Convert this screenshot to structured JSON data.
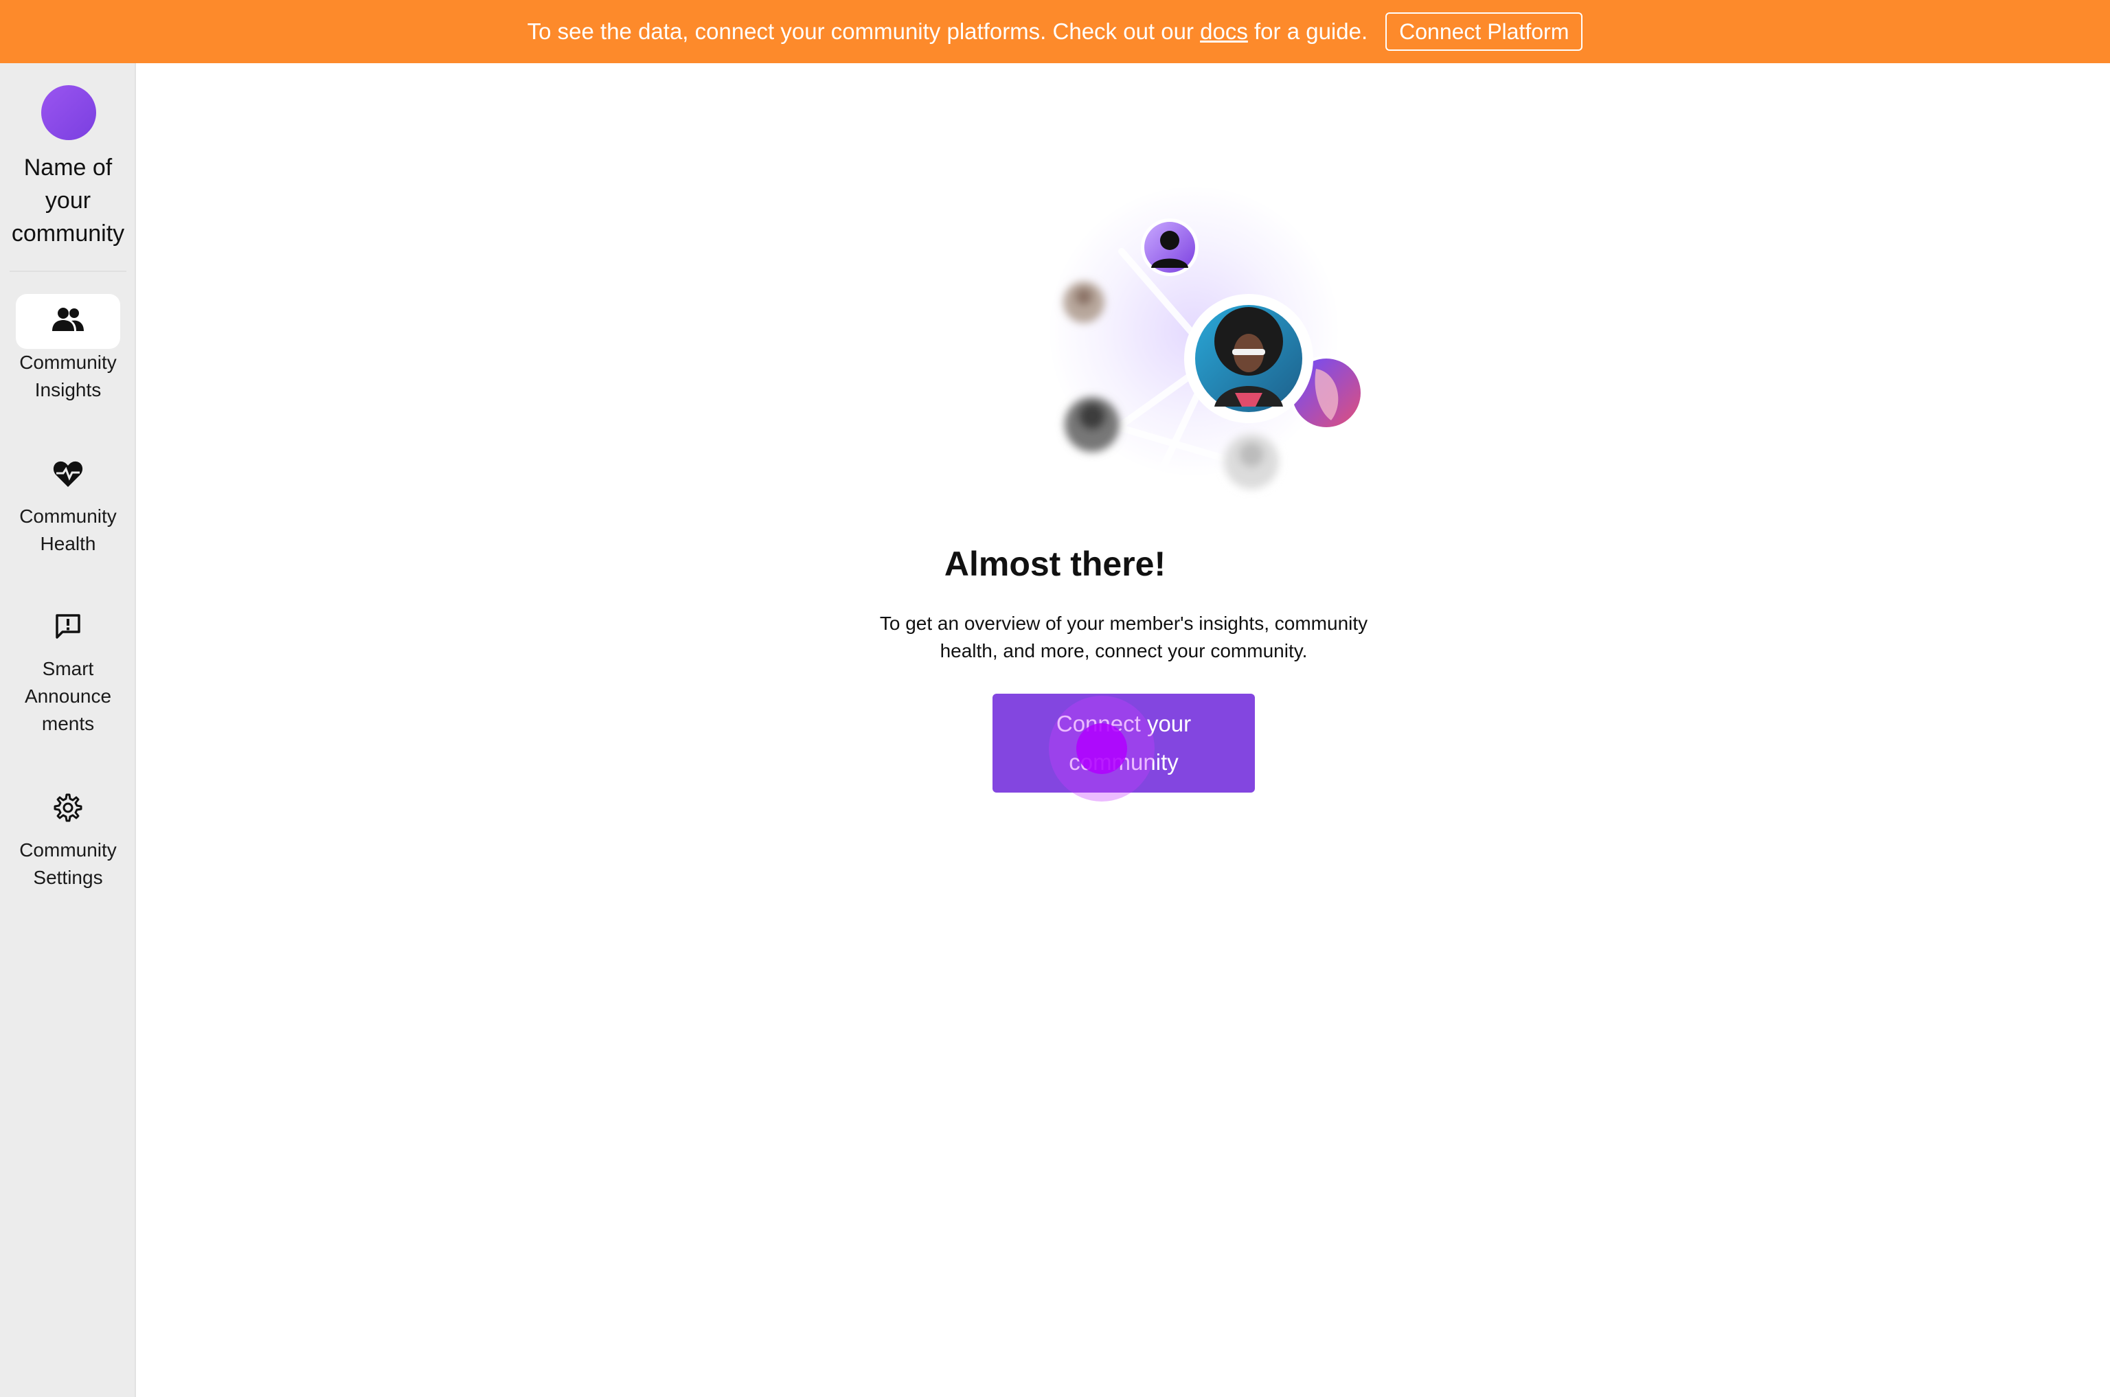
{
  "banner": {
    "text_before": "To see the data, connect your community platforms. Check out our ",
    "link_text": "docs",
    "text_after": " for a guide.",
    "button_label": "Connect Platform",
    "background_color": "#fd8a2b"
  },
  "sidebar": {
    "community_name": "Name of your community",
    "items": [
      {
        "label": "Community Insights",
        "icon": "users-icon",
        "active": true
      },
      {
        "label": "Community Health",
        "icon": "heart-pulse-icon",
        "active": false
      },
      {
        "label": "Smart Announce ments",
        "icon": "announcement-icon",
        "active": false
      },
      {
        "label": "Community Settings",
        "icon": "gear-icon",
        "active": false
      }
    ]
  },
  "main": {
    "heading": "Almost there!",
    "description": "To get an overview of your member's insights, community health, and more, connect your community.",
    "cta_label": "Connect your community",
    "accent_color": "#8346e0"
  },
  "chat": {
    "icon": "chat-bubble-icon"
  }
}
